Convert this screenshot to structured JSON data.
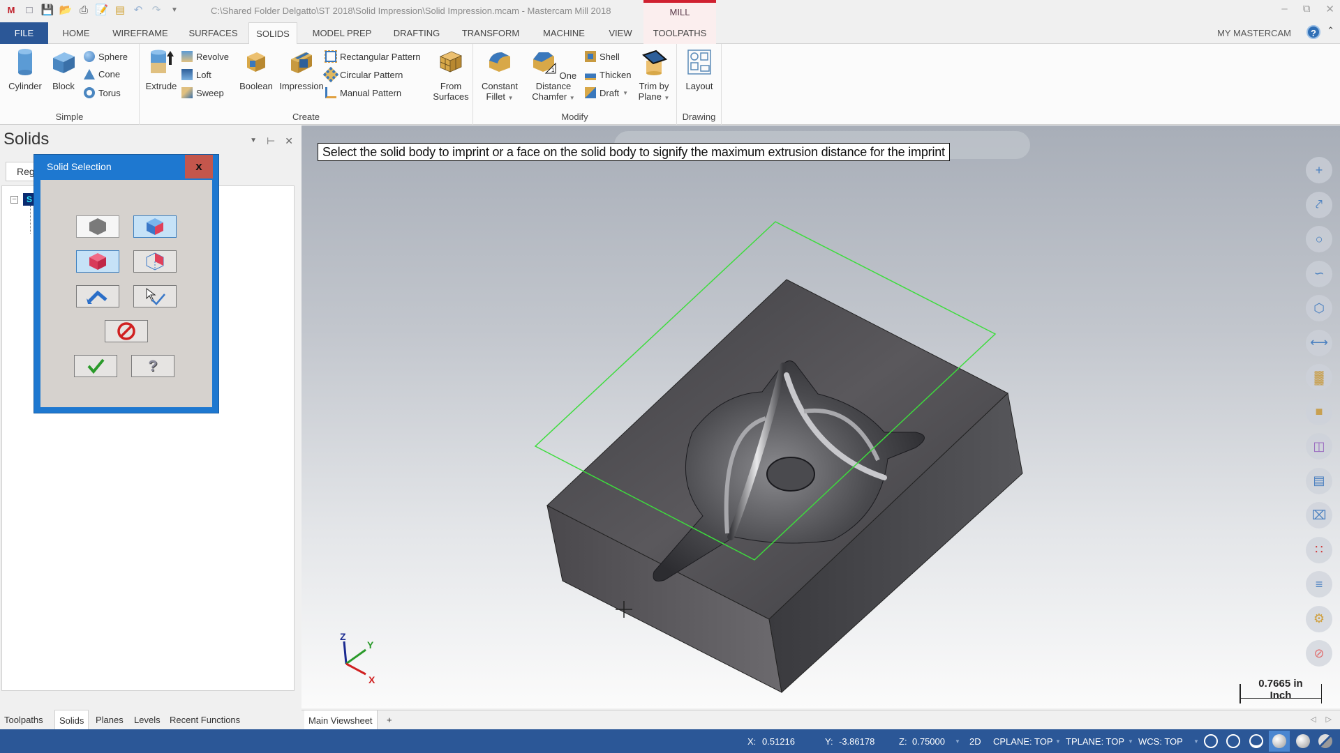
{
  "titlebar": {
    "title": "C:\\Shared Folder Delgatto\\ST 2018\\Solid Impression\\Solid Impression.mcam - Mastercam Mill 2018",
    "context_tab": "MILL",
    "qat_icons": [
      "mastercam-logo-icon",
      "new-file-icon",
      "save-icon",
      "open-icon",
      "print-icon",
      "save-as-icon",
      "file-properties-icon",
      "undo-icon",
      "redo-icon",
      "customize-qat-icon"
    ],
    "window_controls": [
      "minimize-icon",
      "restore-icon",
      "close-icon"
    ]
  },
  "tabs": [
    {
      "label": "FILE"
    },
    {
      "label": "HOME"
    },
    {
      "label": "WIREFRAME"
    },
    {
      "label": "SURFACES"
    },
    {
      "label": "SOLIDS",
      "active": true
    },
    {
      "label": "MODEL PREP"
    },
    {
      "label": "DRAFTING"
    },
    {
      "label": "TRANSFORM"
    },
    {
      "label": "MACHINE"
    },
    {
      "label": "VIEW"
    },
    {
      "label": "TOOLPATHS"
    }
  ],
  "account": {
    "label": "MY MASTERCAM",
    "help": "?",
    "collapse": "^"
  },
  "ribbon": {
    "groups": {
      "simple": {
        "label": "Simple",
        "cylinder": "Cylinder",
        "block": "Block",
        "sphere": "Sphere",
        "cone": "Cone",
        "torus": "Torus"
      },
      "create": {
        "label": "Create",
        "extrude": "Extrude",
        "revolve": "Revolve",
        "loft": "Loft",
        "sweep": "Sweep",
        "boolean": "Boolean",
        "impression": "Impression",
        "rect_pattern": "Rectangular Pattern",
        "circ_pattern": "Circular Pattern",
        "manual_pattern": "Manual Pattern",
        "from_surfaces_1": "From",
        "from_surfaces_2": "Surfaces"
      },
      "modify": {
        "label": "Modify",
        "fillet_1": "Constant",
        "fillet_2": "Fillet",
        "chamfer_1": "One Distance",
        "chamfer_2": "Chamfer",
        "shell": "Shell",
        "thicken": "Thicken",
        "draft": "Draft",
        "trim_1": "Trim by",
        "trim_2": "Plane"
      },
      "drawing": {
        "label": "Drawing",
        "layout": "Layout"
      }
    }
  },
  "panel": {
    "title": "Solids",
    "controls": [
      "dropdown-icon",
      "pin-icon",
      "close-icon"
    ],
    "combo_value": "Reg",
    "tree_node_icon": "S"
  },
  "dialog": {
    "title": "Solid Selection",
    "close": "x",
    "buttons": [
      {
        "name": "select-body-button",
        "icon": "solid-body-icon"
      },
      {
        "name": "select-face-button",
        "icon": "solid-face-icon",
        "selected": true
      },
      {
        "name": "select-solid-button",
        "icon": "solid-cube-icon",
        "selected": true
      },
      {
        "name": "select-background-button",
        "icon": "background-face-icon"
      },
      {
        "name": "select-edge-loop-button",
        "icon": "edge-arrow-icon"
      },
      {
        "name": "verify-selection-button",
        "icon": "verify-icon"
      },
      {
        "name": "clear-selection-button",
        "icon": "no-icon"
      },
      {
        "name": "ok-button",
        "icon": "checkmark-icon"
      },
      {
        "name": "help-button",
        "icon": "help-icon"
      }
    ]
  },
  "viewport": {
    "prompt": "Select the solid body to imprint or a face on the solid body to signify the maximum extrusion distance for the imprint",
    "axes": {
      "x": "X",
      "y": "Y",
      "z": "Z"
    },
    "scale_value": "0.7665 in",
    "scale_unit": "Inch",
    "right_toolbar": [
      "point-icon",
      "line-icon",
      "circle-icon",
      "spline-icon",
      "wireframe-box-icon",
      "dimension-icon",
      "surface-icon",
      "solid-box-icon",
      "mesh-icon",
      "chain-icon",
      "entity-icon",
      "color-icon",
      "levels-icon",
      "settings-icon",
      "no-selection-icon"
    ],
    "colors": {
      "plane_outline": "#3ddc3d",
      "solid": "#4a4a4e"
    }
  },
  "bottom_tabs": [
    {
      "label": "Toolpaths"
    },
    {
      "label": "Solids",
      "active": true
    },
    {
      "label": "Planes"
    },
    {
      "label": "Levels"
    },
    {
      "label": "Recent Functions"
    }
  ],
  "view_tabs": {
    "main": "Main Viewsheet",
    "add": "+"
  },
  "status": {
    "x_label": "X:",
    "x": "0.51216",
    "y_label": "Y:",
    "y": "-3.86178",
    "z_label": "Z:",
    "z": "0.75000",
    "mode": "2D",
    "cplane": "CPLANE: TOP",
    "tplane": "TPLANE: TOP",
    "wcs": "WCS: TOP",
    "display_icons": [
      "wireframe-globe-icon",
      "hidden-globe-icon",
      "partial-globe-icon",
      "shaded-sphere-icon",
      "sphere-icon",
      "translucency-icon"
    ],
    "accent": "#2b5797"
  }
}
